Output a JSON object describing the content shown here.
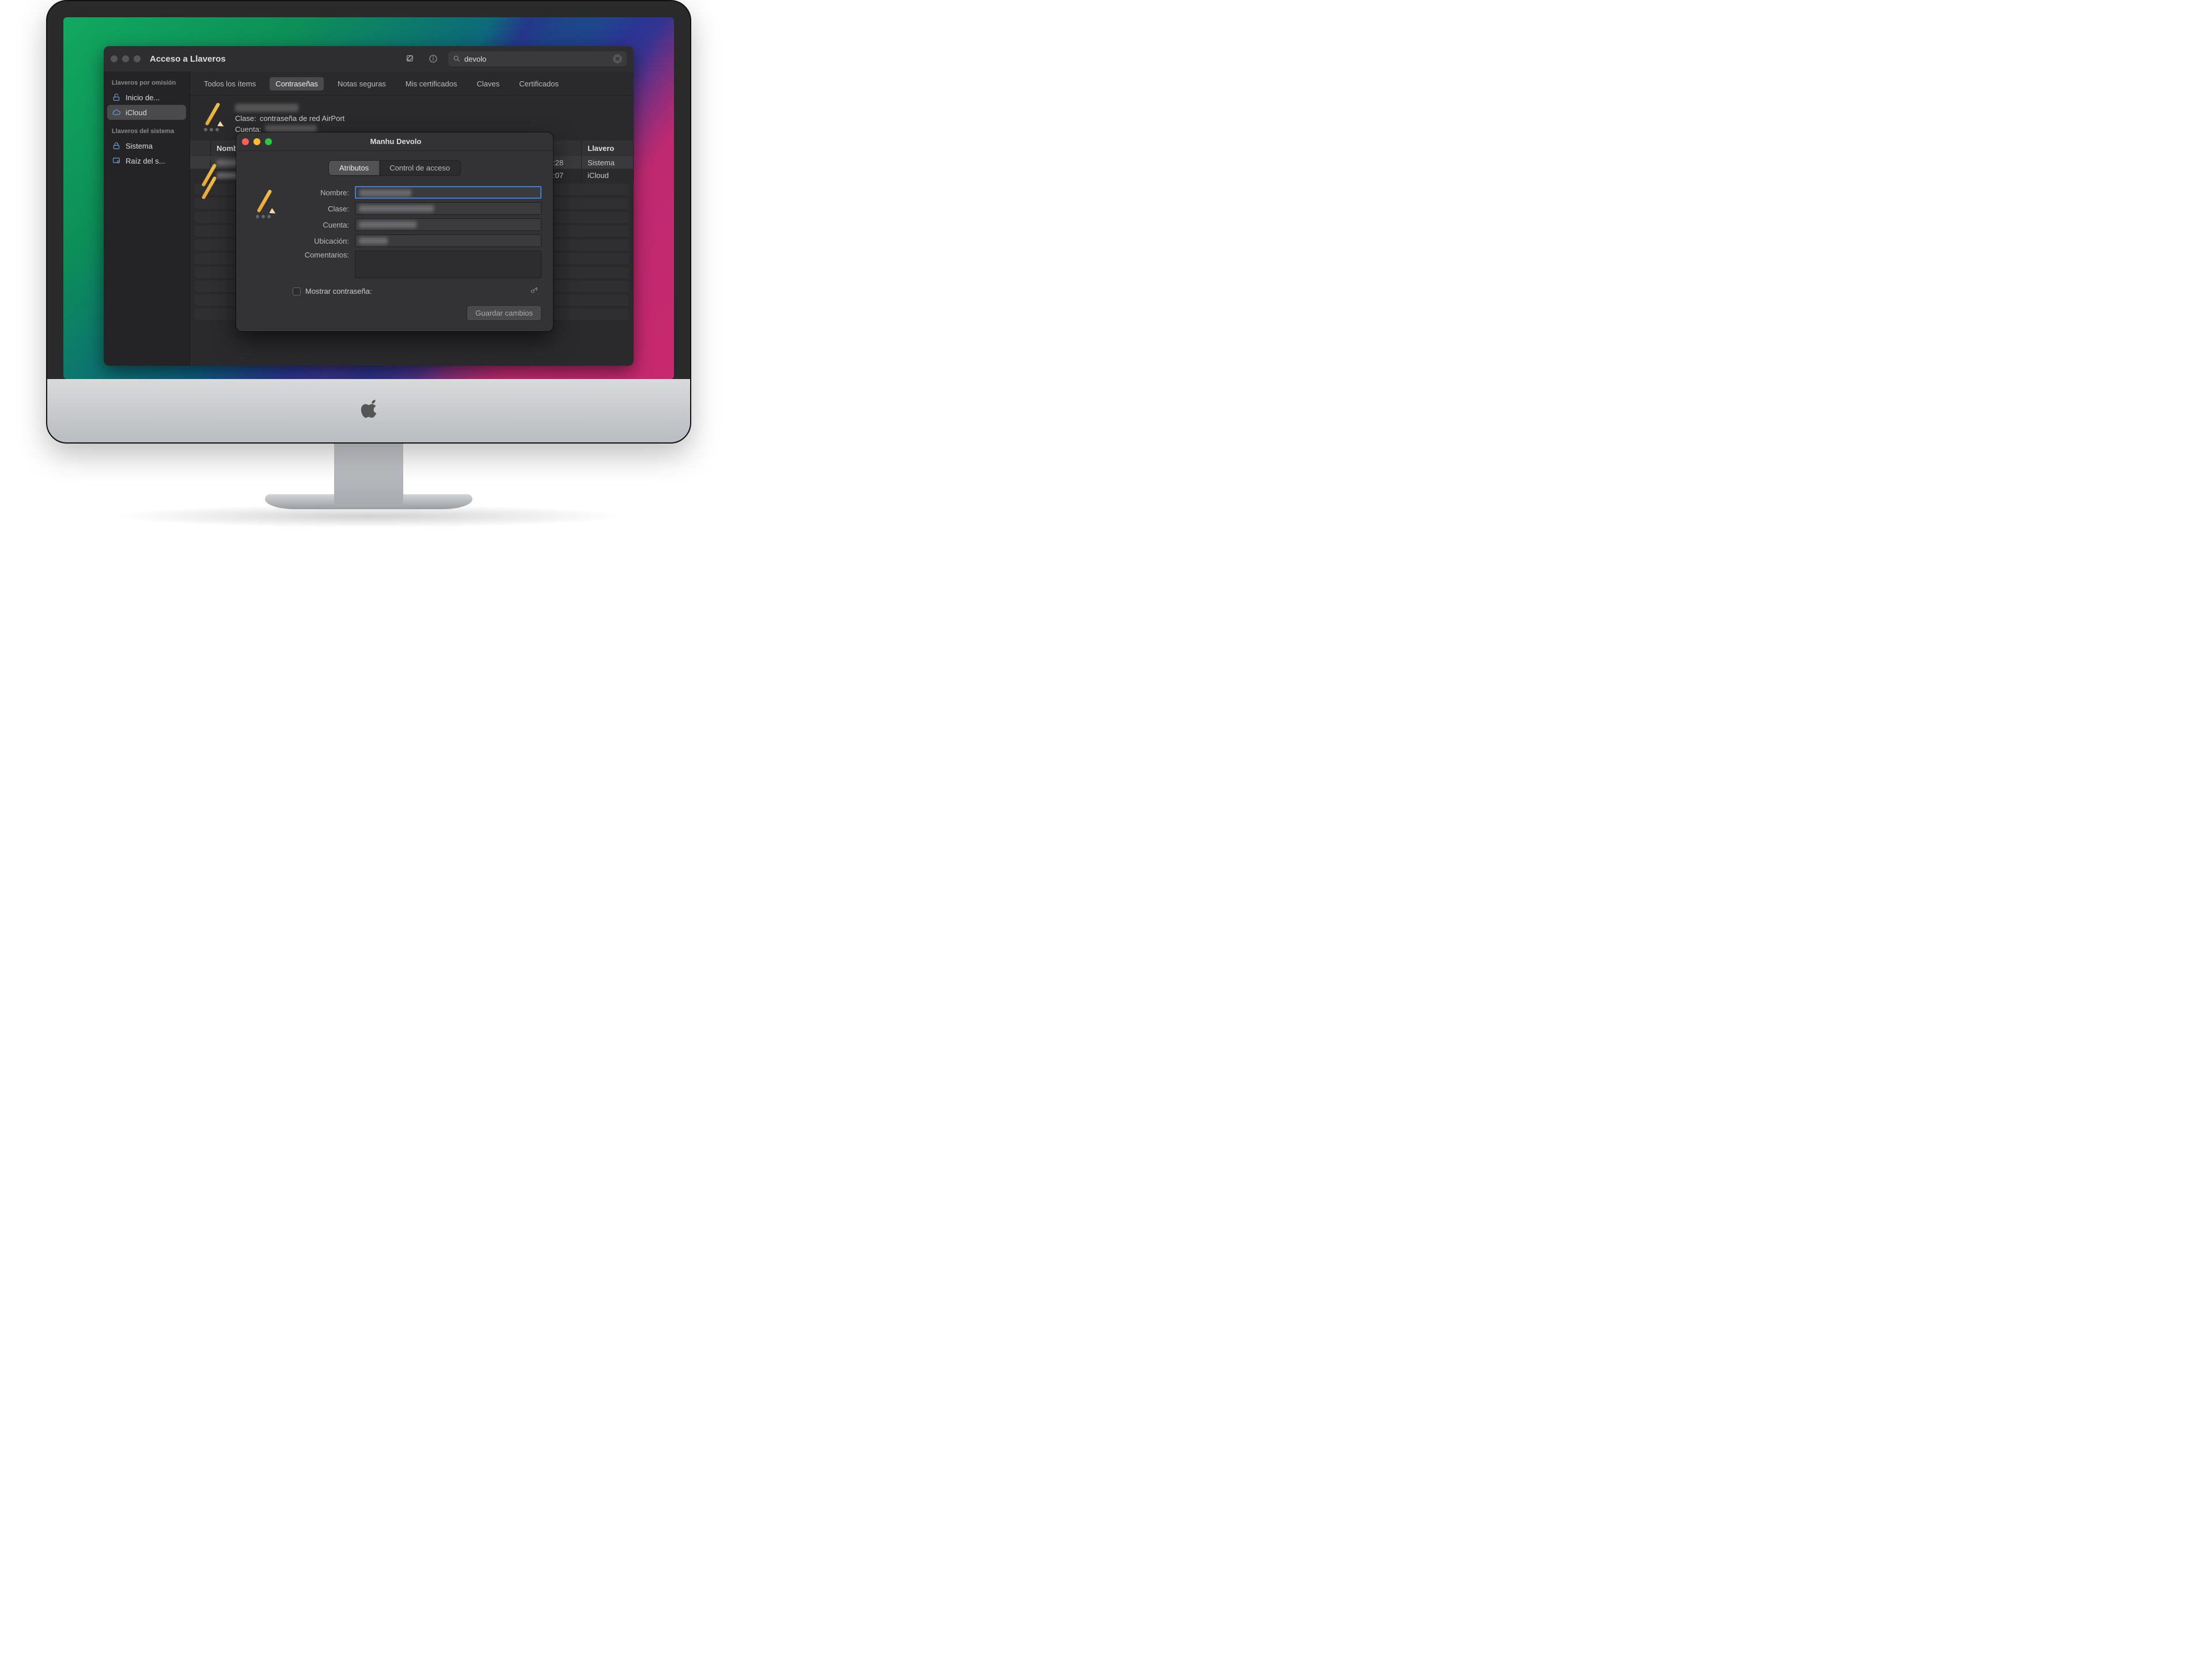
{
  "window": {
    "title": "Acceso a Llaveros",
    "search_value": "devolo",
    "sidebar": {
      "section1_label": "Llaveros por omisión",
      "items1": [
        {
          "label": "Inicio de..."
        },
        {
          "label": "iCloud"
        }
      ],
      "section2_label": "Llaveros del sistema",
      "items2": [
        {
          "label": "Sistema"
        },
        {
          "label": "Raíz del s..."
        }
      ]
    },
    "segments": {
      "all": "Todos los ítems",
      "passwords": "Contraseñas",
      "secure_notes": "Notas seguras",
      "my_certs": "Mis certificados",
      "keys": "Claves",
      "certs": "Certificados"
    },
    "detail": {
      "class_label": "Clase:",
      "class_value": "contraseña de red AirPort",
      "account_label": "Cuenta:"
    },
    "table": {
      "col_name": "Nombre",
      "col_keychain": "Llavero",
      "rows": [
        {
          "time": ":28",
          "keychain": "Sistema"
        },
        {
          "time": ":07",
          "keychain": "iCloud"
        }
      ]
    }
  },
  "modal": {
    "title": "Manhu Devolo",
    "tabs": {
      "attributes": "Atributos",
      "access": "Control de acceso"
    },
    "labels": {
      "name": "Nombre:",
      "class": "Clase:",
      "account": "Cuenta:",
      "location": "Ubicación:",
      "comments": "Comentarios:",
      "show_password": "Mostrar contraseña:",
      "save": "Guardar cambios"
    }
  }
}
